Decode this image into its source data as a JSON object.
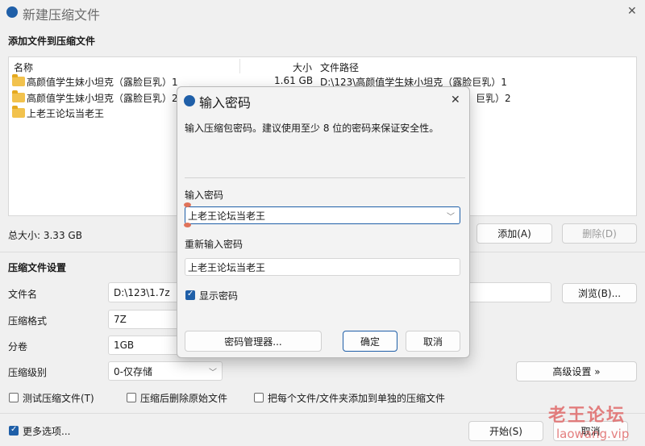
{
  "window": {
    "title": "新建压缩文件",
    "close_glyph": "✕"
  },
  "files_section": {
    "title": "添加文件到压缩文件",
    "columns": {
      "name": "名称",
      "size": "大小",
      "path": "文件路径"
    },
    "rows": [
      {
        "name": "高颜值学生妹小坦克（露脸巨乳）1",
        "size": "1.61 GB",
        "path": "D:\\123\\高颜值学生妹小坦克（露脸巨乳）1"
      },
      {
        "name": "高颜值学生妹小坦克（露脸巨乳）2",
        "size": "",
        "path": "巨乳）2"
      },
      {
        "name": "上老王论坛当老王",
        "size": "",
        "path": ""
      }
    ],
    "total_size": "总大小: 3.33 GB",
    "add_button": "添加(A)",
    "delete_button": "删除(D)"
  },
  "settings": {
    "title": "压缩文件设置",
    "filename_label": "文件名",
    "filename_value": "D:\\123\\1.7z",
    "browse_button": "浏览(B)...",
    "format_label": "压缩格式",
    "format_value": "7Z",
    "volume_label": "分卷",
    "volume_value": "1GB",
    "level_label": "压缩级别",
    "level_value": "0-仅存储",
    "advanced_button": "高级设置 »",
    "checkbox_test": "测试压缩文件(T)",
    "checkbox_delete": "压缩后删除原始文件",
    "checkbox_each": "把每个文件/文件夹添加到单独的压缩文件",
    "more_options": "更多选项...",
    "start_button": "开始(S)",
    "cancel_button": "取消"
  },
  "dialog": {
    "title": "输入密码",
    "description": "输入压缩包密码。建议使用至少 8 位的密码来保证安全性。",
    "password_label": "输入密码",
    "password_value": "上老王论坛当老王",
    "reenter_label": "重新输入密码",
    "reenter_value": "上老王论坛当老王",
    "show_password": "显示密码",
    "manager_button": "密码管理器...",
    "ok_button": "确定",
    "cancel_button": "取消",
    "close_glyph": "✕"
  },
  "watermark": {
    "text": "老王论坛",
    "url": "laowang.vip"
  },
  "colors": {
    "accent": "#1f5fa8",
    "watermark": "#e06a6a"
  }
}
